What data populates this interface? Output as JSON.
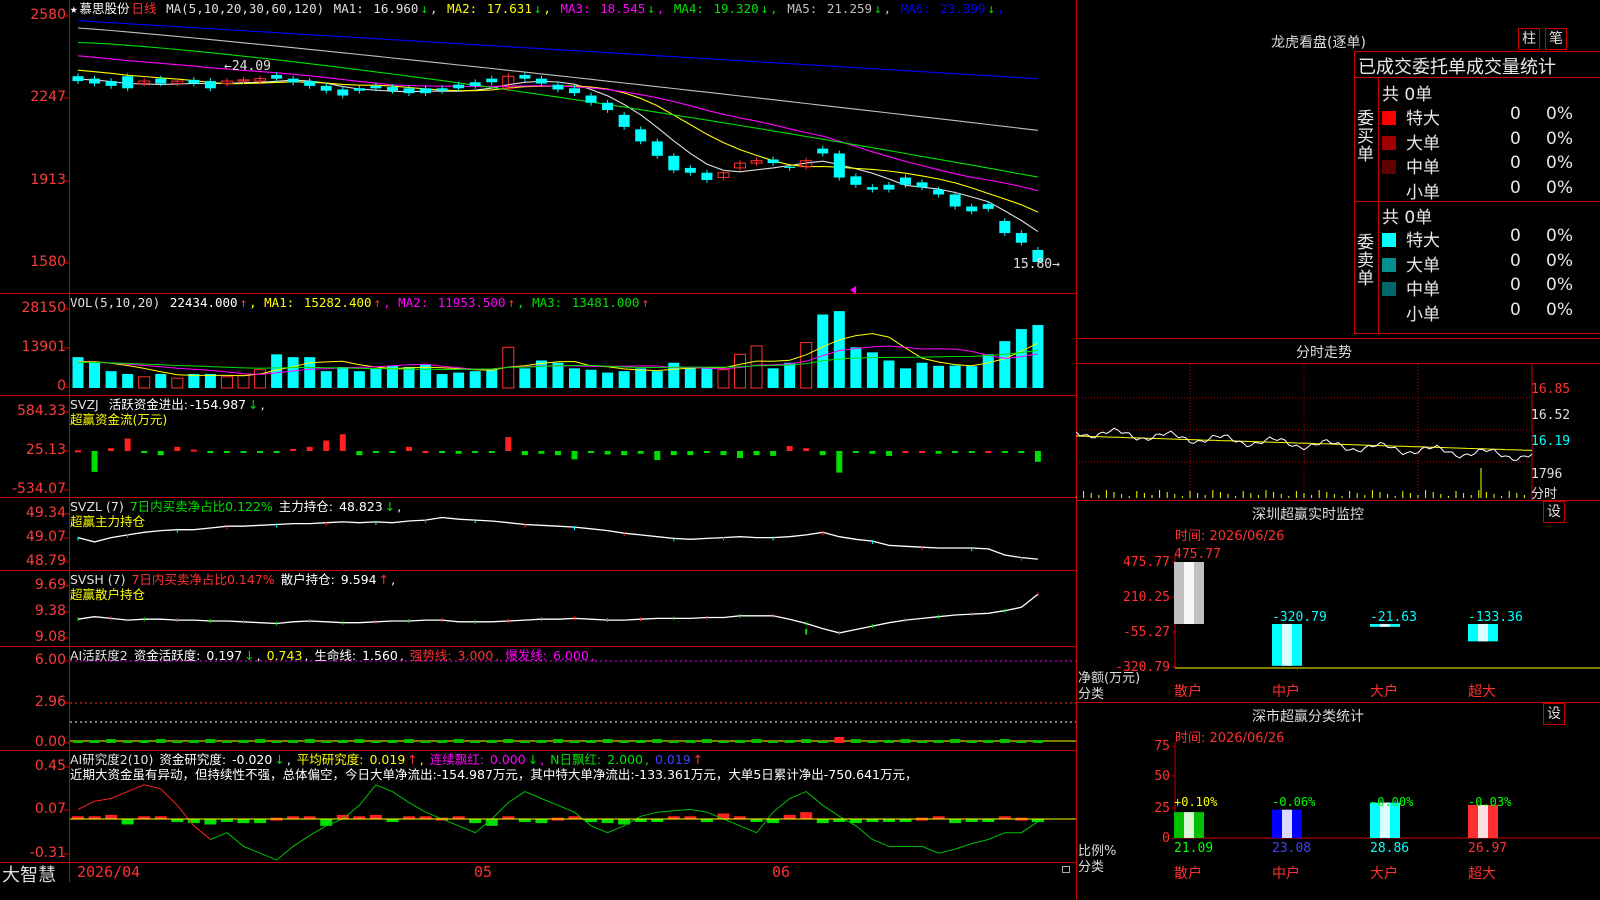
{
  "stock": {
    "star": "★",
    "name": "慕思股份",
    "period": "日线",
    "ma_label": "MA(5,10,20,30,60,120)"
  },
  "price_panel": {
    "mas": [
      {
        "label": "MA1:",
        "value": "16.960",
        "arrow": "↓",
        "color": "#e0e0e0"
      },
      {
        "label": "MA2:",
        "value": "17.631",
        "arrow": "↓",
        "color": "#ffff00"
      },
      {
        "label": "MA3:",
        "value": "18.545",
        "arrow": "↓",
        "color": "#ff00ff"
      },
      {
        "label": "MA4:",
        "value": "19.320",
        "arrow": "↓",
        "color": "#00e000"
      },
      {
        "label": "MA5:",
        "value": "21.259",
        "arrow": "↓",
        "color": "#c0c0c0"
      },
      {
        "label": "MA6:",
        "value": "23.399",
        "arrow": "↓",
        "color": "#0000ff"
      }
    ],
    "axis_labels": [
      "2580",
      "2247",
      "1913",
      "1580"
    ],
    "high_label": "24.09",
    "low_label": "15.80"
  },
  "vol_panel": {
    "title": "VOL(5,10,20)",
    "value": "22434.000",
    "arrow": "↑",
    "mas": [
      {
        "label": "MA1:",
        "value": "15282.400",
        "arrow": "↑",
        "color": "#ffff00"
      },
      {
        "label": "MA2:",
        "value": "11953.500",
        "arrow": "↑",
        "color": "#ff00ff"
      },
      {
        "label": "MA3:",
        "value": "13481.000",
        "arrow": "↑",
        "color": "#00e000"
      }
    ],
    "axis_labels": [
      "28150",
      "13901",
      "0"
    ]
  },
  "svzj_panel": {
    "title": "SVZJ",
    "label": "活跃资金进出:",
    "value": "-154.987",
    "arrow": "↓",
    "sub": "超赢资金流(万元)",
    "axis_labels": [
      "584.33",
      "25.13",
      "-534.07"
    ]
  },
  "svzl_panel": {
    "title": "SVZL (7)",
    "l1": "7日内买卖净占比0.122%",
    "l2": "主力持仓:",
    "value": "48.823",
    "arrow": "↓",
    "sub": "超赢主力持仓",
    "axis_labels": [
      "49.34",
      "49.07",
      "48.79"
    ]
  },
  "svsh_panel": {
    "title": "SVSH (7)",
    "l1": "7日内买卖净占比0.147%",
    "l2": "散户持仓:",
    "value": "9.594",
    "arrow": "↑",
    "sub": "超赢散户持仓",
    "axis_labels": [
      "9.69",
      "9.38",
      "9.08"
    ]
  },
  "ai_active": {
    "title": "AI活跃度2",
    "l1": "资金活跃度:",
    "v1": "0.197",
    "a1": "↓",
    "v2": "0.743",
    "l3": "生命线:",
    "v3": "1.560",
    "l4": "强势线:",
    "v4": "3.000",
    "l5": "爆发线:",
    "v5": "6.000",
    "axis_labels": [
      "6.00",
      "2.96",
      "0.00"
    ]
  },
  "ai_research": {
    "title": "AI研究度2(10)",
    "l1": "资金研究度:",
    "v1": "-0.020",
    "a1": "↓",
    "l2": "平均研究度:",
    "v2": "0.019",
    "a2": "↑",
    "l3": "连续飘红:",
    "v3": "0.000",
    "a3": "↓",
    "l4": "N日飘红:",
    "v4": "2.000",
    "v5": "0.019",
    "a5": "↑",
    "text": "近期大资金虽有异动，但持续性不强，总体偏空，今日大单净流出:-154.987万元，其中特大单净流出:-133.361万元，大单5日累计净出-750.641万元，",
    "axis_labels": [
      "0.45",
      "0.07",
      "-0.31"
    ]
  },
  "x_axis": {
    "logo": "大智慧",
    "d1": "2026/04",
    "d2": "05",
    "d3": "06"
  },
  "right": {
    "lhb_title": "龙虎看盘(逐单)",
    "btn_zhu": "柱",
    "btn_bi": "笔",
    "tabs_line": "已成交委托单成交量统计",
    "buy": {
      "label": "委买单",
      "total": "共 0单",
      "rows": [
        {
          "name": "特大",
          "a": "0",
          "b": "0%",
          "color": "#ff0000"
        },
        {
          "name": "大单",
          "a": "0",
          "b": "0%",
          "color": "#a00000"
        },
        {
          "name": "中单",
          "a": "0",
          "b": "0%",
          "color": "#600000"
        },
        {
          "name": "小单",
          "a": "0",
          "b": "0%",
          "color": "#000000"
        }
      ]
    },
    "sell": {
      "label": "委卖单",
      "total": "共 0单",
      "rows": [
        {
          "name": "特大",
          "a": "0",
          "b": "0%",
          "color": "#00ffff"
        },
        {
          "name": "大单",
          "a": "0",
          "b": "0%",
          "color": "#009090"
        },
        {
          "name": "中单",
          "a": "0",
          "b": "0%",
          "color": "#006868"
        },
        {
          "name": "小单",
          "a": "0",
          "b": "0%",
          "color": "#000000"
        }
      ]
    },
    "intraday": {
      "title": "分时走势",
      "ticks": [
        "16.85",
        "16.52",
        "16.19",
        "1796",
        "分时"
      ]
    },
    "sz_monitor": {
      "title": "深圳超赢实时监控",
      "btn": "设",
      "time": "时间: 2026/06/26",
      "axis": [
        "475.77",
        "210.25",
        "-55.27",
        "-320.79"
      ],
      "ylabel": "净额(万元)",
      "xlabel": "分类",
      "cats": [
        "散户",
        "中户",
        "大户",
        "超大"
      ],
      "values": [
        475.77,
        -320.79,
        -21.63,
        -133.36
      ],
      "value_labels": [
        "475.77",
        "-320.79",
        "-21.63",
        "-133.36"
      ]
    },
    "sz_class": {
      "title": "深市超赢分类统计",
      "btn": "设",
      "time": "时间: 2026/06/26",
      "axis": [
        "75",
        "50",
        "25",
        "0"
      ],
      "ylabel": "比例%",
      "xlabel": "分类",
      "cats": [
        "散户",
        "中户",
        "大户",
        "超大"
      ],
      "values": [
        21.09,
        23.08,
        28.86,
        26.97
      ],
      "value_labels": [
        "21.09",
        "23.08",
        "28.86",
        "26.97"
      ],
      "deltas": [
        "+0.10%",
        "-0.06%",
        "-0.00%",
        "-0.03%"
      ]
    }
  },
  "chart_data": [
    {
      "type": "candlestick",
      "title": "慕思股份 日线",
      "ylim": [
        15.8,
        25.8
      ],
      "x": [
        "2026/04",
        "05",
        "06"
      ],
      "close": [
        23.3,
        23.2,
        23.1,
        23.0,
        23.3,
        23.2,
        23.3,
        23.2,
        23.0,
        23.3,
        23.35,
        23.4,
        23.4,
        23.25,
        23.1,
        22.9,
        22.7,
        22.9,
        23.0,
        22.9,
        22.8,
        22.8,
        22.9,
        23.0,
        23.1,
        23.25,
        23.5,
        23.4,
        23.2,
        22.95,
        22.8,
        22.4,
        22.1,
        21.4,
        20.8,
        20.2,
        19.6,
        19.5,
        19.2,
        19.5,
        19.9,
        20.0,
        19.9,
        19.7,
        20.0,
        20.3,
        19.3,
        19.0,
        18.8,
        18.8,
        19.0,
        18.9,
        18.6,
        18.1,
        17.9,
        18.0,
        17.0,
        16.6,
        15.8
      ],
      "open": [
        23.5,
        23.4,
        23.3,
        23.5,
        23.2,
        23.4,
        23.2,
        23.35,
        23.3,
        23.2,
        23.3,
        23.3,
        23.55,
        23.4,
        23.3,
        23.1,
        22.95,
        23.0,
        23.1,
        23.05,
        23.0,
        23.0,
        23.0,
        23.15,
        23.25,
        23.4,
        23.0,
        23.55,
        23.4,
        23.15,
        23.0,
        22.7,
        22.4,
        21.9,
        21.3,
        20.8,
        20.2,
        19.7,
        19.5,
        19.3,
        19.7,
        19.9,
        20.05,
        19.75,
        19.75,
        20.5,
        20.3,
        19.35,
        18.9,
        19.0,
        19.3,
        19.1,
        18.8,
        18.6,
        18.1,
        18.2,
        17.5,
        17.0,
        16.3
      ],
      "volume": [
        11000,
        9000,
        6000,
        5000,
        4000,
        5000,
        3500,
        5000,
        5000,
        4000,
        4500,
        6500,
        12000,
        11000,
        11000,
        6000,
        7500,
        6000,
        7000,
        8000,
        7500,
        8500,
        5000,
        5500,
        6000,
        6500,
        14500,
        7000,
        9800,
        9000,
        7000,
        6500,
        5500,
        6000,
        7000,
        6000,
        9000,
        7500,
        7000,
        6500,
        12000,
        15000,
        7000,
        9000,
        16200,
        26200,
        27400,
        14500,
        12700,
        9800,
        7000,
        9000,
        7900,
        8000,
        7800,
        12000,
        16700,
        21000,
        22434
      ]
    },
    {
      "type": "bar",
      "title": "超赢资金流(万元)",
      "ylim": [
        -534.07,
        584.33
      ],
      "values": [
        10,
        -300,
        40,
        180,
        -20,
        -60,
        60,
        20,
        -30,
        -20,
        -20,
        -20,
        -20,
        30,
        60,
        150,
        240,
        -60,
        -30,
        -20,
        60,
        0,
        -20,
        -40,
        -20,
        -20,
        200,
        -60,
        -40,
        -60,
        -120,
        -20,
        -50,
        -60,
        -40,
        -130,
        -60,
        -60,
        -20,
        -60,
        -100,
        -60,
        -70,
        70,
        40,
        -60,
        -310,
        -20,
        -40,
        -70,
        0,
        0,
        -40,
        -20,
        -20,
        0,
        -10,
        -20,
        -154.987
      ]
    },
    {
      "type": "line",
      "title": "超赢主力持仓",
      "ylim": [
        48.79,
        49.34
      ],
      "values": [
        49.07,
        49.02,
        49.07,
        49.1,
        49.13,
        49.15,
        49.16,
        49.16,
        49.18,
        49.2,
        49.2,
        49.21,
        49.22,
        49.23,
        49.23,
        49.24,
        49.25,
        49.24,
        49.25,
        49.24,
        49.26,
        49.27,
        49.3,
        49.28,
        49.27,
        49.26,
        49.24,
        49.22,
        49.21,
        49.2,
        49.19,
        49.17,
        49.15,
        49.12,
        49.1,
        49.08,
        49.06,
        49.05,
        49.06,
        49.07,
        49.08,
        49.07,
        49.07,
        49.08,
        49.1,
        49.13,
        49.08,
        49.05,
        49.03,
        48.98,
        48.97,
        48.96,
        48.95,
        48.95,
        48.95,
        48.94,
        48.87,
        48.84,
        48.823
      ]
    },
    {
      "type": "line",
      "title": "超赢散户持仓",
      "ylim": [
        9.08,
        9.69
      ],
      "values": [
        9.3,
        9.33,
        9.31,
        9.29,
        9.3,
        9.3,
        9.29,
        9.29,
        9.28,
        9.28,
        9.27,
        9.26,
        9.25,
        9.27,
        9.28,
        9.27,
        9.26,
        9.26,
        9.27,
        9.28,
        9.28,
        9.29,
        9.29,
        9.27,
        9.27,
        9.27,
        9.28,
        9.29,
        9.3,
        9.3,
        9.31,
        9.3,
        9.29,
        9.29,
        9.3,
        9.31,
        9.31,
        9.31,
        9.32,
        9.32,
        9.34,
        9.34,
        9.34,
        9.3,
        9.25,
        9.19,
        9.14,
        9.18,
        9.22,
        9.26,
        9.29,
        9.31,
        9.33,
        9.35,
        9.36,
        9.37,
        9.4,
        9.44,
        9.594
      ]
    },
    {
      "type": "line",
      "title": "AI研究度2(10)",
      "ylim": [
        -0.31,
        0.45
      ],
      "values": [
        0.07,
        0.13,
        0.15,
        0.2,
        0.25,
        0.22,
        0.1,
        -0.05,
        -0.15,
        -0.1,
        -0.2,
        -0.25,
        -0.3,
        -0.2,
        -0.12,
        -0.05,
        0.0,
        0.1,
        0.25,
        0.2,
        0.12,
        0.05,
        0.0,
        -0.05,
        -0.1,
        0.0,
        0.12,
        0.2,
        0.15,
        0.1,
        0.05,
        -0.05,
        -0.1,
        -0.05,
        0.02,
        0.05,
        0.06,
        0.07,
        0.05,
        0.0,
        -0.05,
        -0.1,
        0.05,
        0.15,
        0.2,
        0.1,
        0.02,
        -0.05,
        -0.15,
        -0.2,
        -0.2,
        -0.2,
        -0.25,
        -0.22,
        -0.18,
        -0.15,
        -0.1,
        -0.1,
        -0.02
      ],
      "bars": [
        0.02,
        0.02,
        0.03,
        -0.04,
        0.02,
        0.02,
        -0.01,
        -0.03,
        -0.04,
        -0.02,
        -0.03,
        -0.03,
        0.01,
        0.02,
        0.02,
        -0.05,
        0.03,
        0.02,
        0.03,
        -0.02,
        0.02,
        0.02,
        0.01,
        0.02,
        -0.03,
        -0.05,
        0.02,
        -0.02,
        -0.03,
        0.01,
        0.02,
        -0.02,
        -0.03,
        -0.04,
        -0.02,
        -0.01,
        0.02,
        0.02,
        -0.01,
        0.04,
        0.02,
        -0.02,
        -0.03,
        0.03,
        0.05,
        -0.03,
        -0.02,
        -0.03,
        -0.02,
        -0.02,
        -0.02,
        0.01,
        0.02,
        -0.03,
        -0.02,
        -0.02,
        0.02,
        0.01,
        -0.02
      ]
    }
  ]
}
